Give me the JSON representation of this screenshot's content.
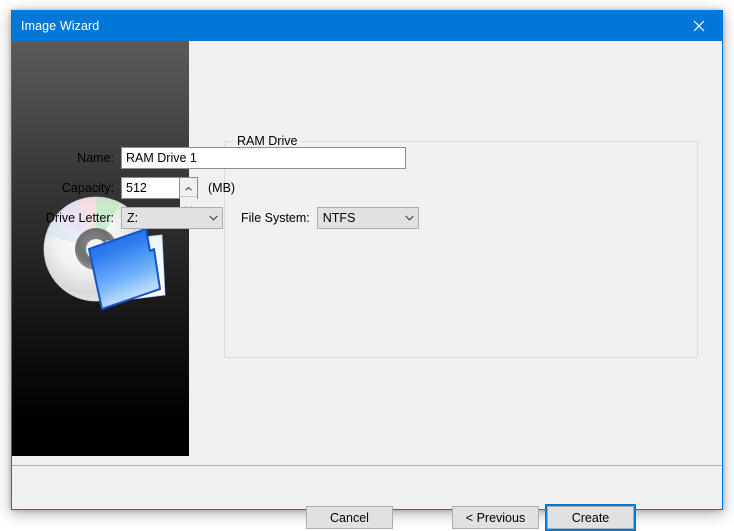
{
  "window": {
    "title": "Image Wizard",
    "close_icon": "close-icon",
    "titlebar_color": "#0078d7",
    "background_color": "#f0f0f0",
    "border_color": "#0078d7"
  },
  "sidebar": {
    "artwork": "disc-with-folder-icon",
    "gradient_from": "#5a5a5a",
    "gradient_to": "#000000"
  },
  "groupbox": {
    "label": "RAM Drive"
  },
  "form": {
    "name": {
      "label": "Name:",
      "value": "RAM Drive 1",
      "placeholder": ""
    },
    "capacity": {
      "label": "Capacity:",
      "value": "512",
      "unit": "(MB)",
      "spin_up_icon": "chevron-up-icon",
      "spin_down_icon": "chevron-down-icon"
    },
    "drive_letter": {
      "label": "Drive Letter:",
      "value": "Z:",
      "arrow_icon": "chevron-down-icon"
    },
    "file_system": {
      "label": "File System:",
      "value": "NTFS",
      "arrow_icon": "chevron-down-icon"
    }
  },
  "buttons": {
    "cancel": "Cancel",
    "previous": "< Previous",
    "create": "Create",
    "default_button_accent": "#0078d7"
  }
}
